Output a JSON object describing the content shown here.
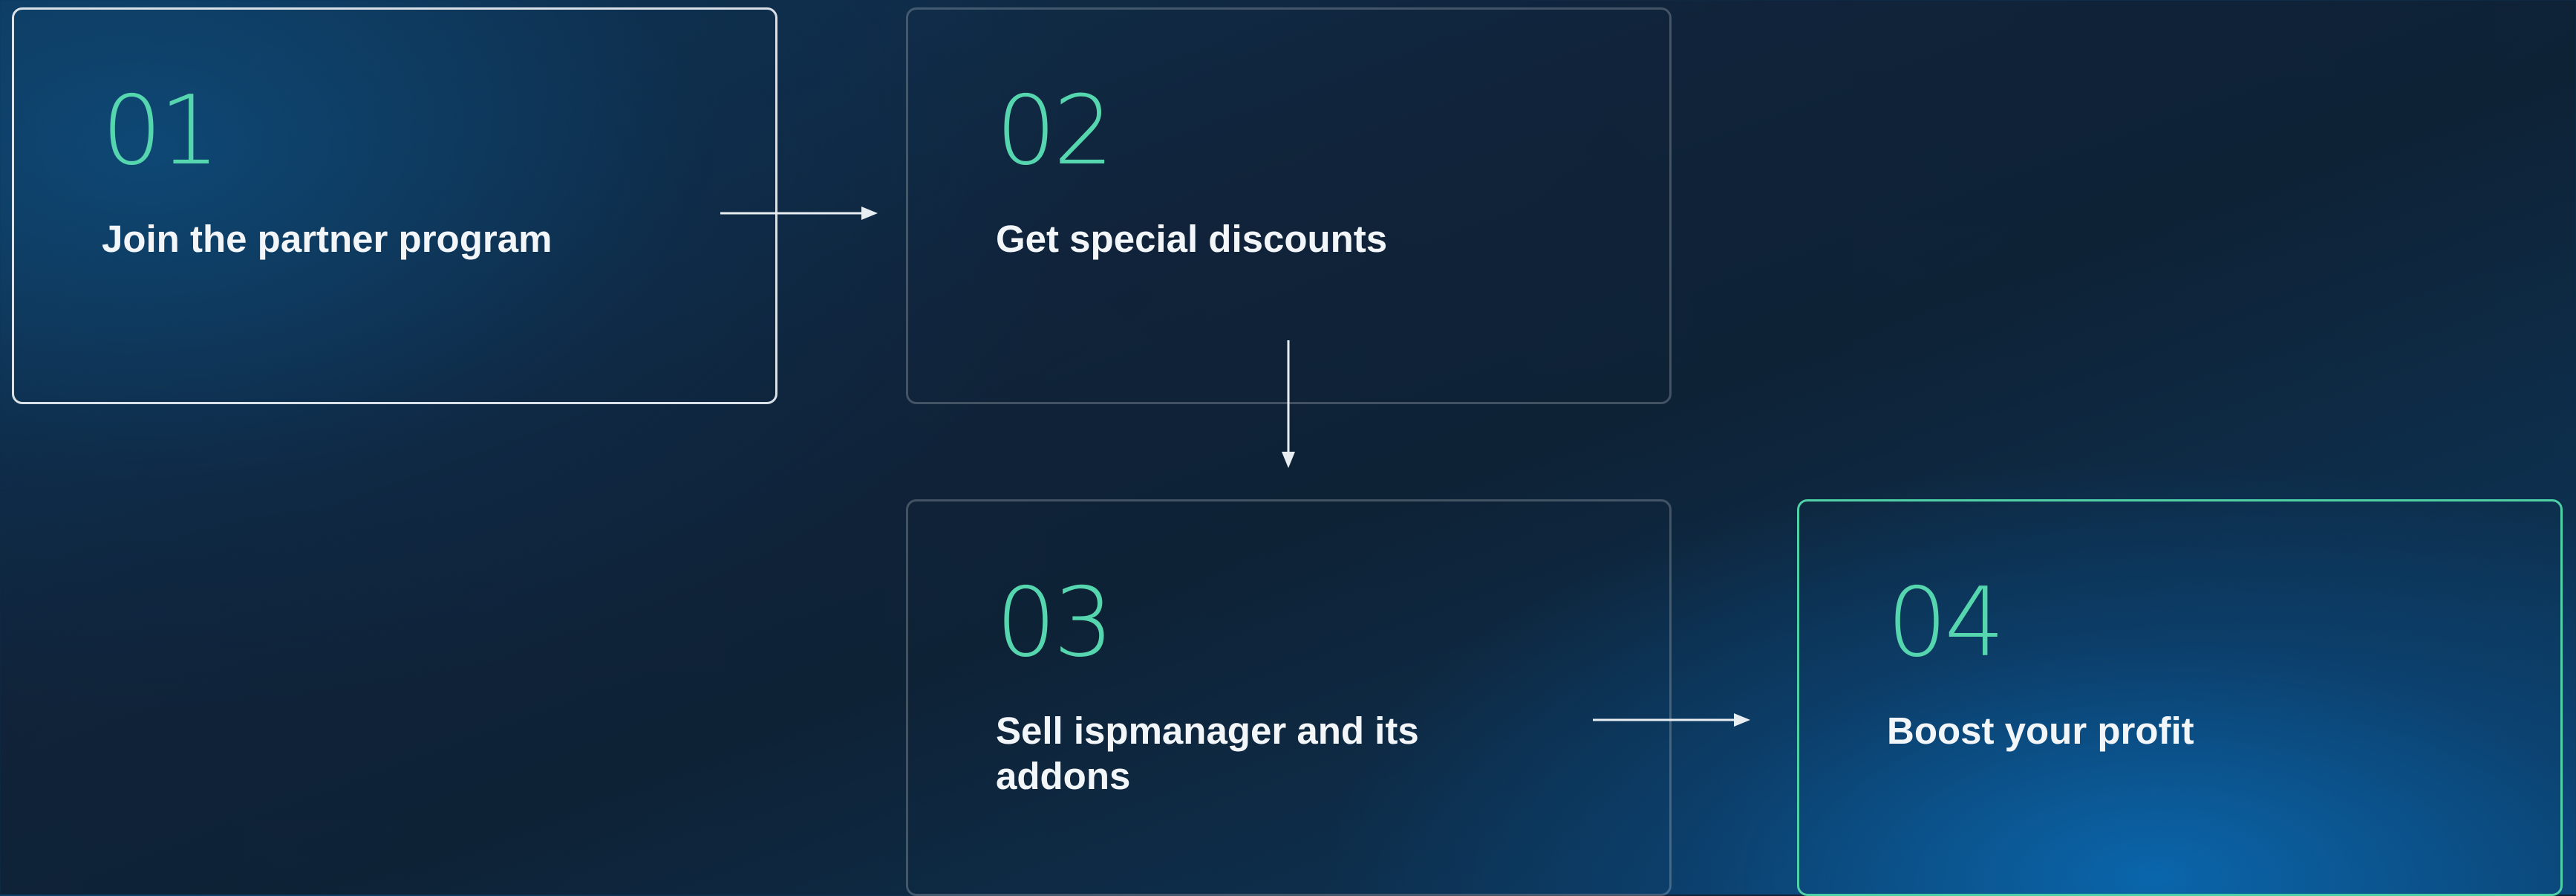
{
  "steps": [
    {
      "number": "01",
      "label": "Join the partner program"
    },
    {
      "number": "02",
      "label": "Get special discounts"
    },
    {
      "number": "03",
      "label": "Sell ispmanager and its addons"
    },
    {
      "number": "04",
      "label": "Boost your profit"
    }
  ],
  "colors": {
    "accent": "#56d6ae",
    "card_border": "rgba(255,255,255,0.22)",
    "active_border": "#4fd1a8",
    "text": "#f3f6f9"
  }
}
